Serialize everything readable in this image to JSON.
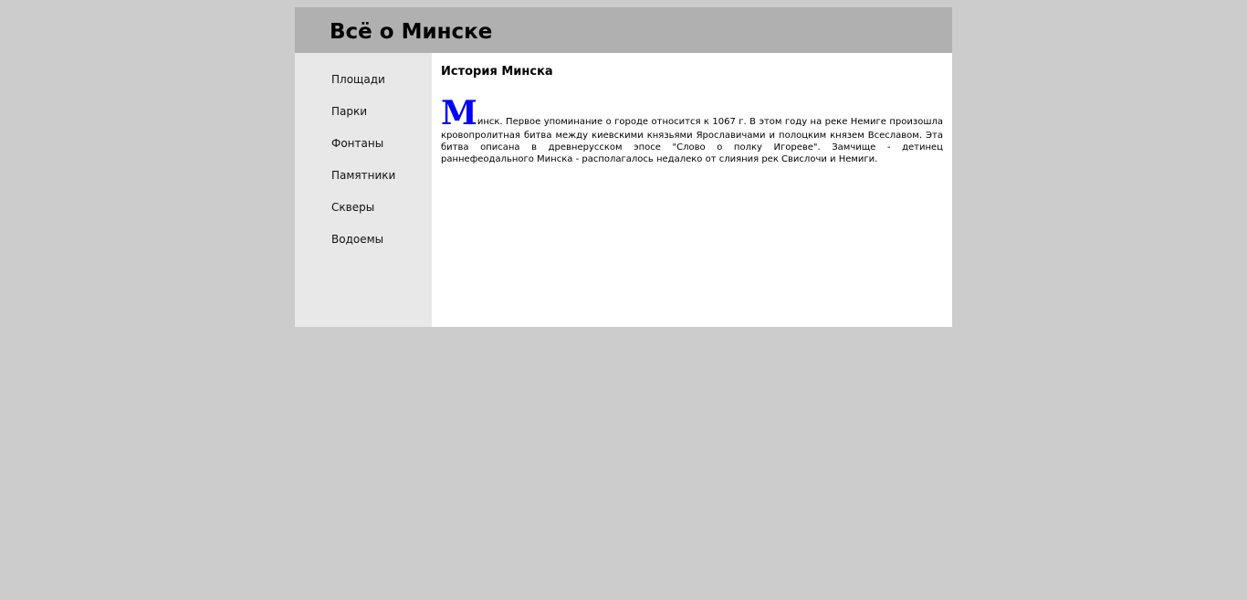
{
  "header": {
    "title": "Всё о Минске"
  },
  "sidebar": {
    "items": [
      {
        "label": "Площади"
      },
      {
        "label": "Парки"
      },
      {
        "label": "Фонтаны"
      },
      {
        "label": "Памятники"
      },
      {
        "label": "Скверы"
      },
      {
        "label": "Водоемы"
      }
    ]
  },
  "article": {
    "title": "История Минска",
    "drop_cap": "М",
    "body": "инск. Первое упоминание о городе относится к 1067 г. В этом году на реке Немиге произошла кровопролитная битва между киевскими князьями Ярославичами и полоцким князем Всеславом. Эта битва описана в древнерусском эпосе \"Слово о полку Игореве\". Замчище - детинец раннефеодального Минска - располагалось недалеко от слияния рек Свислочи и Немиги."
  },
  "colors": {
    "page_background": "#cccccc",
    "header_background": "#b0b0b0",
    "sidebar_background": "#e8e8e8",
    "content_background": "#ffffff",
    "drop_cap": "#0000ff"
  }
}
